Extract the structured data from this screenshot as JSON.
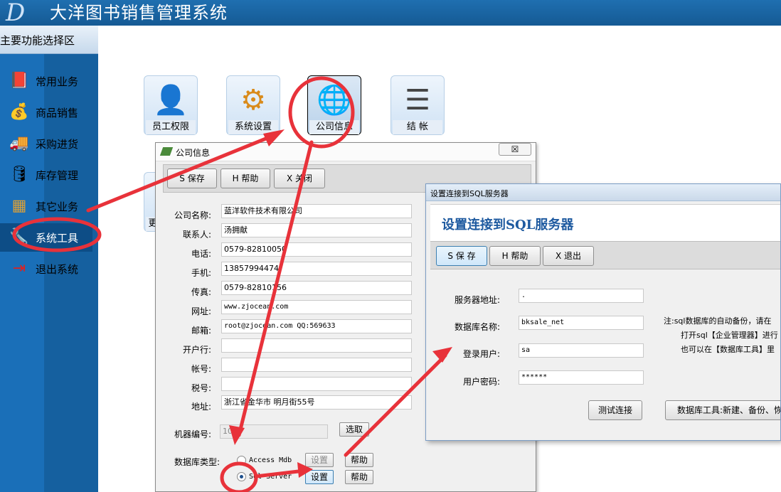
{
  "app": {
    "logo": "D",
    "title": "大洋图书销售管理系统"
  },
  "sidebar": {
    "header": "主要功能选择区",
    "items": [
      {
        "label": "常用业务",
        "icon": "book-icon",
        "glyph": "📕"
      },
      {
        "label": "商品销售",
        "icon": "coins-icon",
        "glyph": "💰"
      },
      {
        "label": "采购进货",
        "icon": "truck-icon",
        "glyph": "🚚"
      },
      {
        "label": "库存管理",
        "icon": "database-icon",
        "glyph": "🛢"
      },
      {
        "label": "其它业务",
        "icon": "calendar-icon",
        "glyph": "▦"
      },
      {
        "label": "系统工具",
        "icon": "tools-icon",
        "glyph": "🔧"
      },
      {
        "label": "退出系统",
        "icon": "exit-icon",
        "glyph": "⇥"
      }
    ]
  },
  "tools": [
    {
      "label": "员工权限",
      "icon": "user-icon",
      "glyph": "👤"
    },
    {
      "label": "系统设置",
      "icon": "gear-icon",
      "glyph": "⚙"
    },
    {
      "label": "公司信息",
      "icon": "globe-icon",
      "glyph": "🌐"
    },
    {
      "label": "结 帐",
      "icon": "ledger-icon",
      "glyph": "☰"
    }
  ],
  "hidden_tool_label": "更",
  "company_window": {
    "title": "公司信息",
    "close": "☒",
    "buttons": {
      "save": "S 保存",
      "help": "H 帮助",
      "close": "X 关闭"
    },
    "fields": [
      {
        "label": "公司名称:",
        "value": "蓝洋软件技术有限公司",
        "mono": false
      },
      {
        "label": "联系人:",
        "value": "汤拥献",
        "mono": false
      },
      {
        "label": "电话:",
        "value": "0579-82810050",
        "mono": false
      },
      {
        "label": "手机:",
        "value": "13857994474",
        "mono": false
      },
      {
        "label": "传真:",
        "value": "0579-82810156",
        "mono": false
      },
      {
        "label": "网址:",
        "value": "www.zjocean.com",
        "mono": true
      },
      {
        "label": "邮箱:",
        "value": "root@zjocean.com  QQ:569633",
        "mono": true
      },
      {
        "label": "开户行:",
        "value": "",
        "mono": false
      },
      {
        "label": "帐号:",
        "value": "",
        "mono": false
      },
      {
        "label": "税号:",
        "value": "",
        "mono": false
      },
      {
        "label": "地址:",
        "value": "浙江省金华市 明月街55号",
        "mono": false
      }
    ],
    "machine": {
      "label": "机器编号:",
      "value": "10",
      "button": "选取"
    },
    "db": {
      "label": "数据库类型:",
      "options": [
        {
          "label": "Access Mdb",
          "selected": false,
          "setting": "设置",
          "help": "帮助"
        },
        {
          "label": "Sql Server",
          "selected": true,
          "setting": "设置",
          "help": "帮助"
        }
      ]
    }
  },
  "sql_window": {
    "title": "设置连接到SQL服务器",
    "heading": "设置连接到SQL服务器",
    "buttons": {
      "save": "S 保 存",
      "help": "H 帮助",
      "exit": "X 退出"
    },
    "fields": [
      {
        "label": "服务器地址:",
        "value": "."
      },
      {
        "label": "数据库名称:",
        "value": "bksale_net"
      },
      {
        "label": "登录用户:",
        "value": "sa"
      },
      {
        "label": "用户密码:",
        "value": "******"
      }
    ],
    "note": [
      "注:sql数据库的自动备份，请在",
      "打开sql【企业管理器】进行",
      "也可以在【数据库工具】里"
    ],
    "test_button": "测试连接",
    "db_tools_button": "数据库工具:新建、备份、恢"
  },
  "annotation_color": "#e8323a"
}
